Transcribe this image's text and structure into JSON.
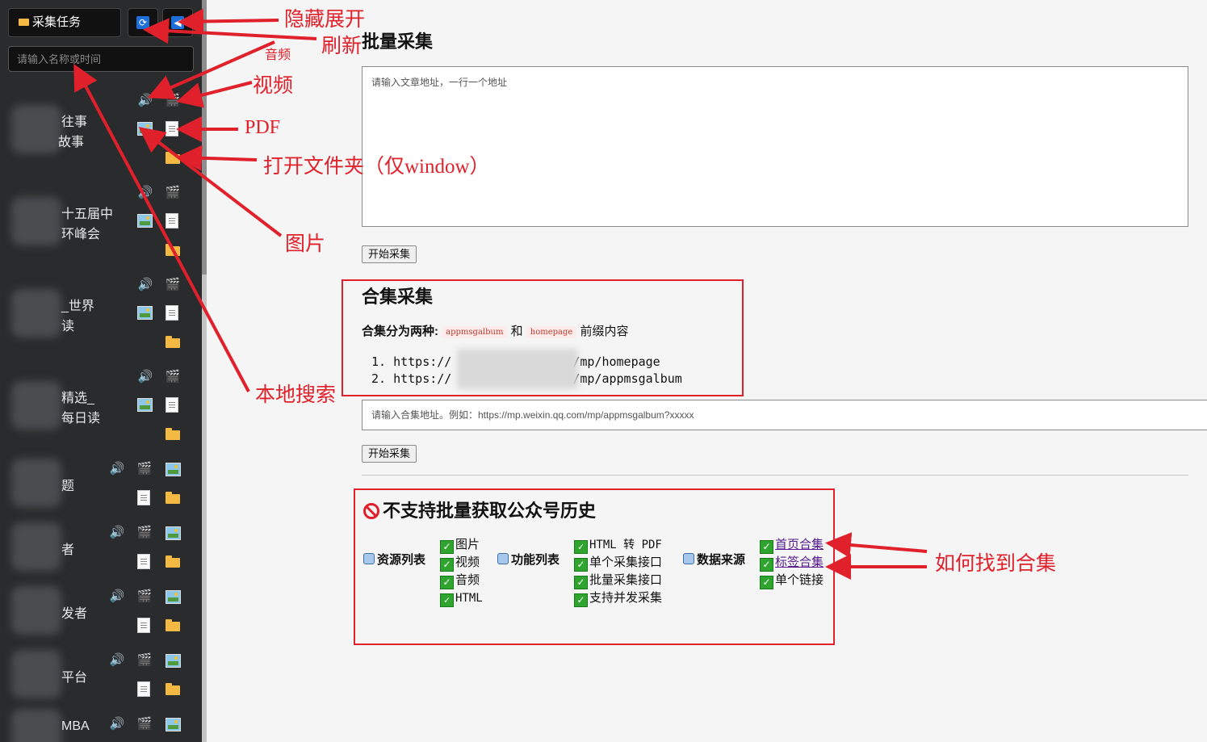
{
  "sidebar": {
    "task_button_label": "采集任务",
    "search_placeholder": "请输入名称或时间",
    "items": [
      {
        "line1": "往事",
        "line2": "故事"
      },
      {
        "line1": "十五届中",
        "line2": "环峰会"
      },
      {
        "line1": "_世界",
        "line2": "读"
      },
      {
        "line1": "精选_",
        "line2": "每日读"
      },
      {
        "line1": "题",
        "line2": ""
      },
      {
        "line1": "者",
        "line2": ""
      },
      {
        "line1": "发者",
        "line2": ""
      },
      {
        "line1": "平台",
        "line2": ""
      },
      {
        "line1": "MBA",
        "line2": ""
      }
    ]
  },
  "icons": {
    "refresh": "refresh-icon",
    "toggle": "toggle-sidebar-icon",
    "audio": "speaker-icon",
    "video": "clapperboard-icon",
    "image": "picture-icon",
    "pdf": "document-icon",
    "folder": "folder-icon"
  },
  "batch": {
    "title": "批量采集",
    "textarea_placeholder": "请输入文章地址，一行一个地址",
    "start_button": "开始采集"
  },
  "collection": {
    "title": "合集采集",
    "intro_label": "合集分为两种:",
    "tag1": "appmsgalbum",
    "and_text": "和",
    "tag2": "homepage",
    "suffix": "前缀内容",
    "list": [
      {
        "num": "1.",
        "prefix": "https://",
        "suffix": "/mp/homepage"
      },
      {
        "num": "2.",
        "prefix": "https://",
        "suffix": "/mp/appmsgalbum"
      }
    ],
    "input_placeholder": "请输入合集地址。例如：https://mp.weixin.qq.com/mp/appmsgalbum?xxxxx",
    "start_button": "开始采集"
  },
  "features": {
    "title": "不支持批量获取公众号历史",
    "resources": {
      "label": "资源列表",
      "items": [
        "图片",
        "视频",
        "音频",
        "HTML"
      ]
    },
    "functions": {
      "label": "功能列表",
      "items": [
        "HTML 转 PDF",
        "单个采集接口",
        "批量采集接口",
        "支持并发采集"
      ]
    },
    "sources": {
      "label": "数据来源",
      "items": [
        "首页合集",
        "标签合集",
        "单个链接"
      ]
    }
  },
  "annotations": {
    "toggle": "隐藏展开",
    "refresh": "刷新",
    "audio": "音频",
    "video": "视频",
    "pdf": "PDF",
    "folder": "打开文件夹（仅window）",
    "image": "图片",
    "search": "本地搜索",
    "find_collection": "如何找到合集"
  },
  "colors": {
    "sidebar_bg": "#2a2b2d",
    "accent_blue": "#1e6fd9",
    "annotation_red": "#e0202a",
    "check_green": "#2fa52f"
  }
}
